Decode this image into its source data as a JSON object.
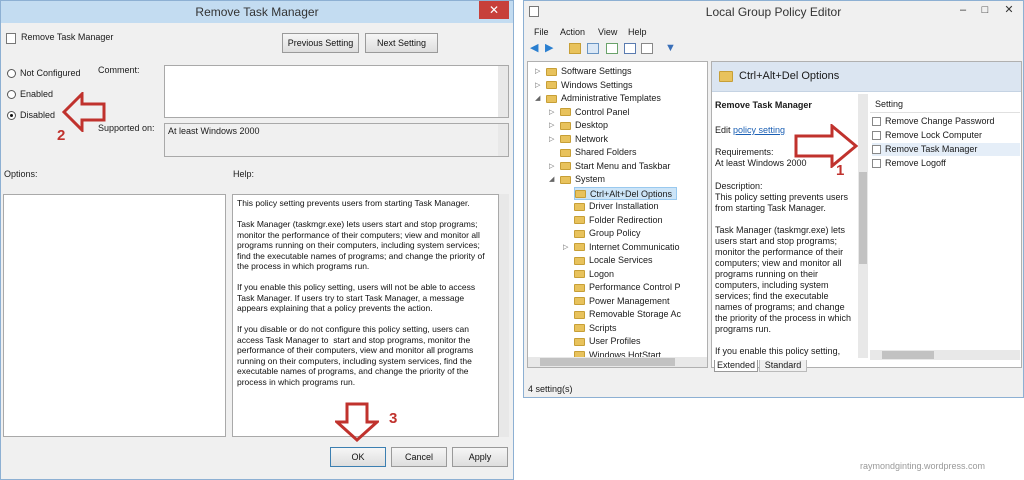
{
  "left_dialog": {
    "title": "Remove Task Manager",
    "header_title": "Remove Task Manager",
    "prev_button": "Previous Setting",
    "next_button": "Next Setting",
    "radio_not_configured": "Not Configured",
    "radio_enabled": "Enabled",
    "radio_disabled": "Disabled",
    "comment_label": "Comment:",
    "supported_label": "Supported on:",
    "supported_value": "At least Windows 2000",
    "options_label": "Options:",
    "help_label": "Help:",
    "help_text": "This policy setting prevents users from starting Task Manager.\n\nTask Manager (taskmgr.exe) lets users start and stop programs; monitor the performance of their computers; view and monitor all programs running on their computers, including system services; find the executable names of programs; and change the priority of the process in which programs run.\n\nIf you enable this policy setting, users will not be able to access Task Manager. If users try to start Task Manager, a message appears explaining that a policy prevents the action.\n\nIf you disable or do not configure this policy setting, users can access Task Manager to  start and stop programs, monitor the performance of their computers, view and monitor all programs running on their computers, including system services, find the executable names of programs, and change the priority of the process in which programs run.",
    "ok_button": "OK",
    "cancel_button": "Cancel",
    "apply_button": "Apply",
    "selected_radio": "Disabled"
  },
  "annotations": {
    "n1": "1",
    "n2": "2",
    "n3": "3",
    "color": "#c0322d"
  },
  "gpedit": {
    "title": "Local Group Policy Editor",
    "menu": [
      "File",
      "Action",
      "View",
      "Help"
    ],
    "tree": [
      {
        "label": "Software Settings",
        "level": 1,
        "expander": "right"
      },
      {
        "label": "Windows Settings",
        "level": 1,
        "expander": "right"
      },
      {
        "label": "Administrative Templates",
        "level": 1,
        "expander": "down"
      },
      {
        "label": "Control Panel",
        "level": 2,
        "expander": "right"
      },
      {
        "label": "Desktop",
        "level": 2,
        "expander": "right"
      },
      {
        "label": "Network",
        "level": 2,
        "expander": "right"
      },
      {
        "label": "Shared Folders",
        "level": 2,
        "expander": ""
      },
      {
        "label": "Start Menu and Taskbar",
        "level": 2,
        "expander": "right"
      },
      {
        "label": "System",
        "level": 2,
        "expander": "down"
      },
      {
        "label": "Ctrl+Alt+Del Options",
        "level": 3,
        "expander": "",
        "selected": true
      },
      {
        "label": "Driver Installation",
        "level": 3,
        "expander": ""
      },
      {
        "label": "Folder Redirection",
        "level": 3,
        "expander": ""
      },
      {
        "label": "Group Policy",
        "level": 3,
        "expander": ""
      },
      {
        "label": "Internet Communicatio",
        "level": 3,
        "expander": "right"
      },
      {
        "label": "Locale Services",
        "level": 3,
        "expander": ""
      },
      {
        "label": "Logon",
        "level": 3,
        "expander": ""
      },
      {
        "label": "Performance Control P",
        "level": 3,
        "expander": ""
      },
      {
        "label": "Power Management",
        "level": 3,
        "expander": ""
      },
      {
        "label": "Removable Storage Ac",
        "level": 3,
        "expander": ""
      },
      {
        "label": "Scripts",
        "level": 3,
        "expander": ""
      },
      {
        "label": "User Profiles",
        "level": 3,
        "expander": ""
      },
      {
        "label": "Windows HotStart",
        "level": 3,
        "expander": ""
      }
    ],
    "folder_header": "Ctrl+Alt+Del Options",
    "desc_title": "Remove Task Manager",
    "desc_edit_prefix": "Edit ",
    "desc_edit_link": "policy setting",
    "desc_requirements": "Requirements:\nAt least Windows 2000",
    "desc_body": "Description:\nThis policy setting prevents users from starting Task Manager.\n\nTask Manager (taskmgr.exe) lets users start and stop programs; monitor the performance of their computers; view and monitor all programs running on their computers, including system services; find the executable names of programs; and change the priority of the process in which programs run.\n\nIf you enable this policy setting,",
    "settings_header": "Setting",
    "settings": [
      "Remove Change Password",
      "Remove Lock Computer",
      "Remove Task Manager",
      "Remove Logoff"
    ],
    "tab_extended": "Extended",
    "tab_standard": "Standard",
    "status": "4 setting(s)"
  },
  "watermark": "raymondginting.wordpress.com"
}
